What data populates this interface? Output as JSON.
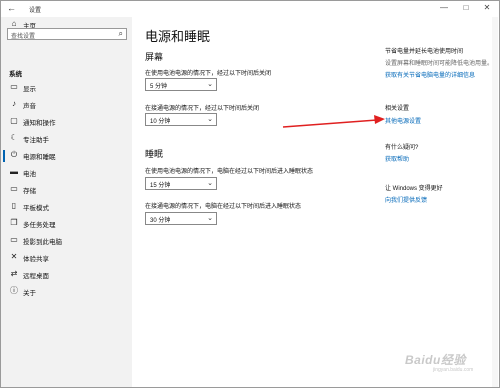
{
  "titlebar": {
    "back": "←",
    "title": "设置",
    "minimize": "—",
    "maximize": "□",
    "close": "✕"
  },
  "sidebar": {
    "home": {
      "label": "主页",
      "icon": "home-icon"
    },
    "search": {
      "placeholder": "查找设置",
      "icon": "search-icon"
    },
    "category": "系统",
    "items": [
      {
        "label": "显示",
        "icon": "display-icon",
        "glyph": "▭"
      },
      {
        "label": "声音",
        "icon": "sound-icon",
        "glyph": "♪"
      },
      {
        "label": "通知和操作",
        "icon": "notification-icon",
        "glyph": "▢"
      },
      {
        "label": "专注助手",
        "icon": "moon-icon",
        "glyph": "☾"
      },
      {
        "label": "电源和睡眠",
        "icon": "power-icon",
        "glyph": "⏻",
        "active": true
      },
      {
        "label": "电池",
        "icon": "battery-icon",
        "glyph": "▬"
      },
      {
        "label": "存储",
        "icon": "storage-icon",
        "glyph": "▭"
      },
      {
        "label": "平板模式",
        "icon": "tablet-icon",
        "glyph": "▯"
      },
      {
        "label": "多任务处理",
        "icon": "multitask-icon",
        "glyph": "❐"
      },
      {
        "label": "投影到此电脑",
        "icon": "project-icon",
        "glyph": "▭"
      },
      {
        "label": "体验共享",
        "icon": "share-icon",
        "glyph": "✕"
      },
      {
        "label": "远程桌面",
        "icon": "remote-desktop-icon",
        "glyph": "⇄"
      },
      {
        "label": "关于",
        "icon": "info-icon",
        "glyph": "ⓘ"
      }
    ]
  },
  "main": {
    "title": "电源和睡眠",
    "screen": {
      "heading": "屏幕",
      "battery_label": "在使用电池电源的情况下，经过以下时间后关闭",
      "battery_value": "5 分钟",
      "plugged_label": "在接通电源的情况下，经过以下时间后关闭",
      "plugged_value": "10 分钟"
    },
    "sleep": {
      "heading": "睡眠",
      "battery_label": "在使用电池电源的情况下，电脑在经过以下时间后进入睡眠状态",
      "battery_value": "15 分钟",
      "plugged_label": "在接通电源的情况下，电脑在经过以下时间后进入睡眠状态",
      "plugged_value": "30 分钟"
    }
  },
  "right": {
    "tip_title": "节省电量并延长电池使用时间",
    "tip_text": "设置屏幕和睡眠时间可能降低电池用量。",
    "tip_link": "获取有关节省电脑电量的详细信息",
    "related_title": "相关设置",
    "related_link": "其他电源设置",
    "question_title": "有什么疑问?",
    "question_link": "获取帮助",
    "improve_title": "让 Windows 变得更好",
    "improve_link": "向我们提供反馈"
  },
  "watermark": {
    "brand": "Baidu经验",
    "url": "jingyan.baidu.com"
  },
  "colors": {
    "accent": "#0063b1",
    "link": "#0067b8",
    "annotation_arrow": "#e02020"
  }
}
